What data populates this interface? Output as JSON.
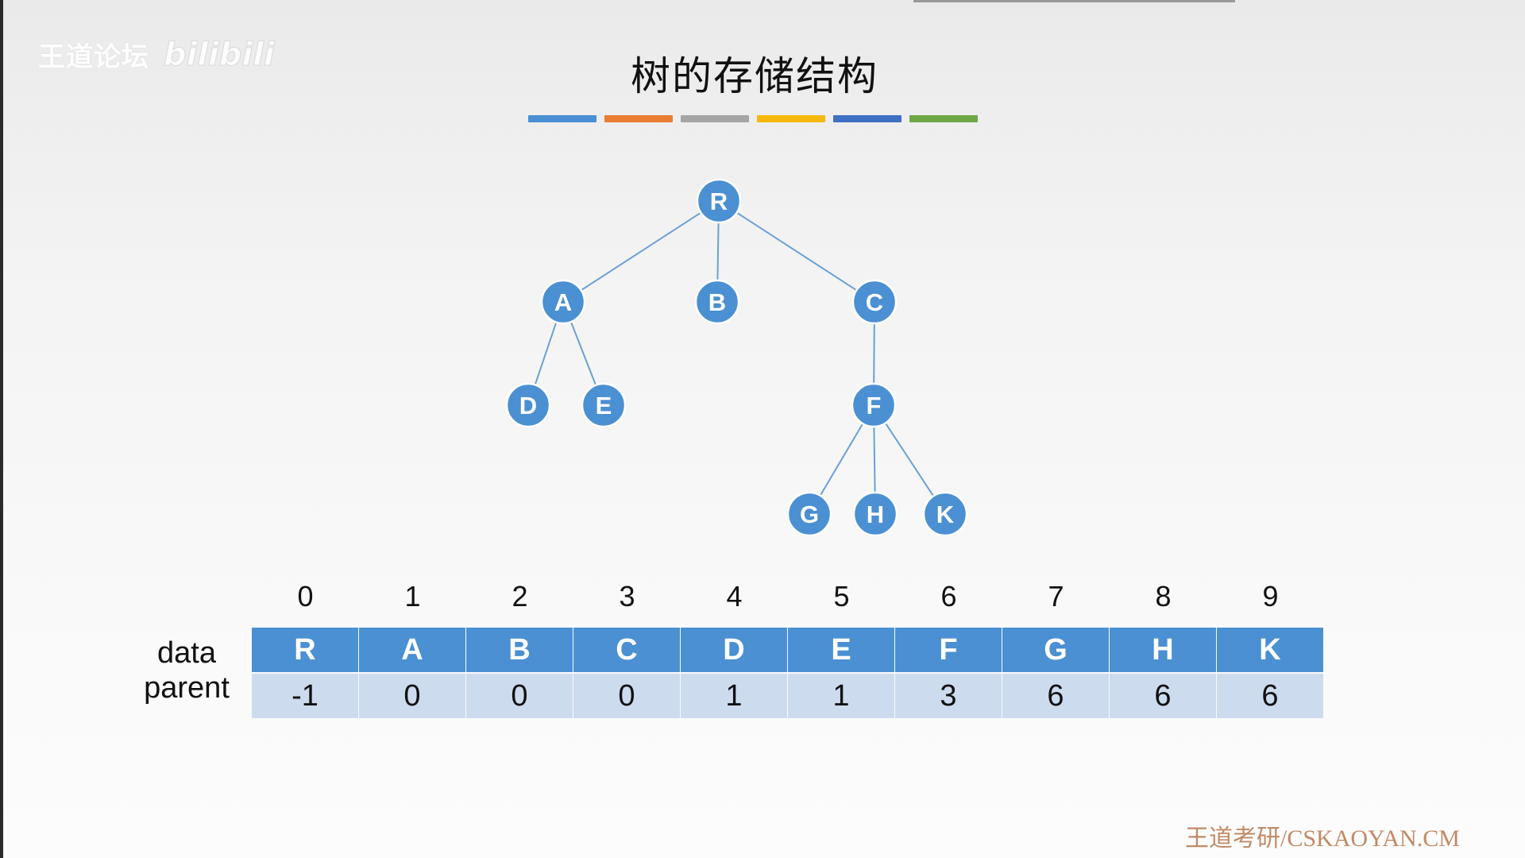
{
  "watermark": {
    "text": "王道论坛",
    "logo": "bilibili"
  },
  "title": "树的存储结构",
  "stripe_colors": [
    "#4a8fd4",
    "#ea7d33",
    "#a5a5a5",
    "#f6b80f",
    "#3f6fc2",
    "#6ea846"
  ],
  "colors": {
    "node": "#4a90d2",
    "edge": "#6aa0d6",
    "data_cell": "#4a90d2",
    "parent_cell": "#cddbef"
  },
  "tree": {
    "nodes": [
      "R",
      "A",
      "B",
      "C",
      "D",
      "E",
      "F",
      "G",
      "H",
      "K"
    ],
    "edges": [
      [
        "R",
        "A"
      ],
      [
        "R",
        "B"
      ],
      [
        "R",
        "C"
      ],
      [
        "A",
        "D"
      ],
      [
        "A",
        "E"
      ],
      [
        "C",
        "F"
      ],
      [
        "F",
        "G"
      ],
      [
        "F",
        "H"
      ],
      [
        "F",
        "K"
      ]
    ]
  },
  "table": {
    "row_labels": {
      "data": "data",
      "parent": "parent"
    },
    "indices": [
      "0",
      "1",
      "2",
      "3",
      "4",
      "5",
      "6",
      "7",
      "8",
      "9"
    ],
    "data": [
      "R",
      "A",
      "B",
      "C",
      "D",
      "E",
      "F",
      "G",
      "H",
      "K"
    ],
    "parent": [
      "-1",
      "0",
      "0",
      "0",
      "1",
      "1",
      "3",
      "6",
      "6",
      "6"
    ]
  },
  "footer": "王道考研/CSKAOYAN.CM"
}
